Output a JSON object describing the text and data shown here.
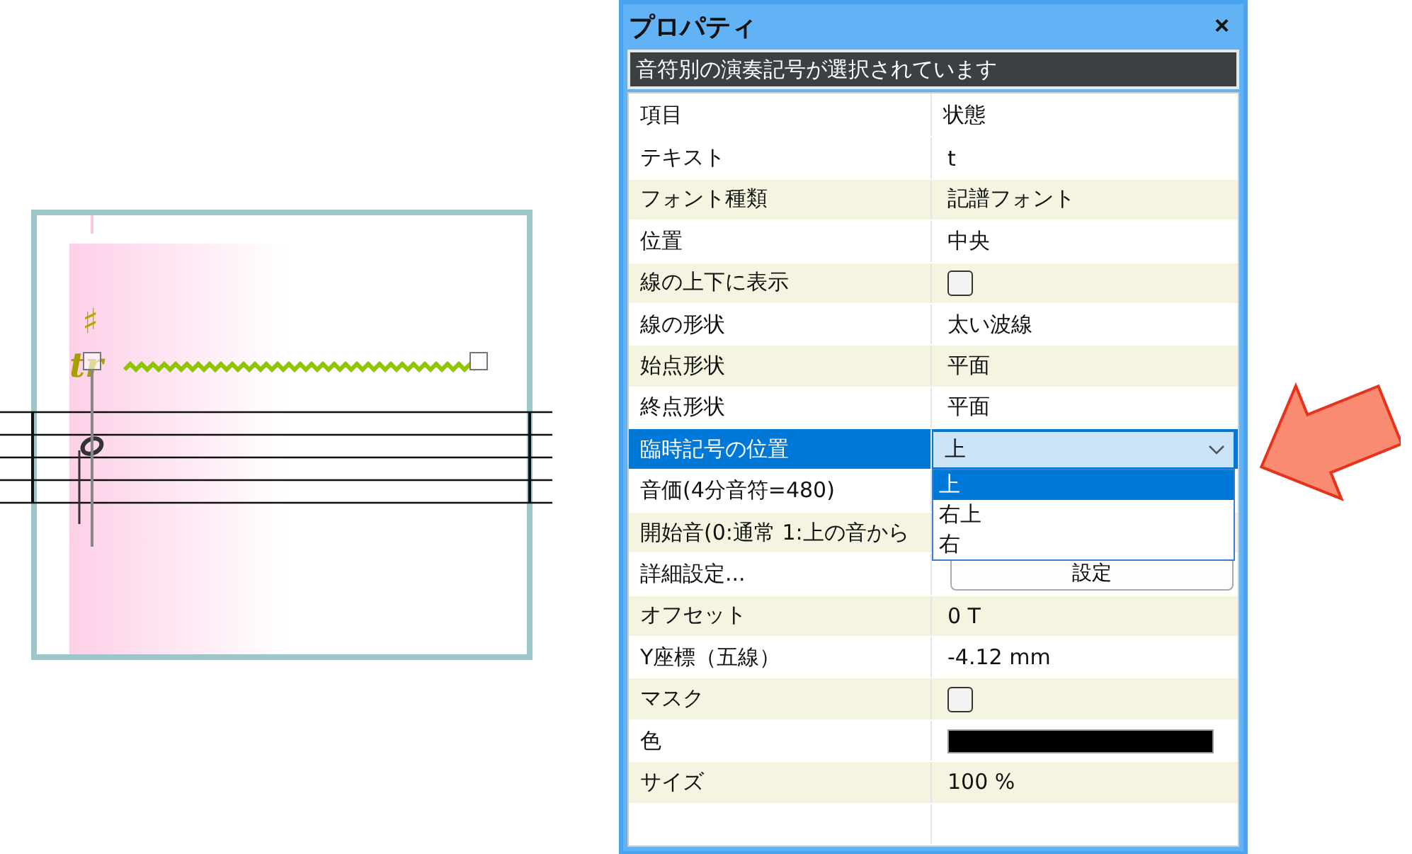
{
  "score": {
    "accidental": "♯",
    "ornament": "tr"
  },
  "panel": {
    "title": "プロパティ",
    "close": "×",
    "status": "音符別の演奏記号が選択されています",
    "columns": [
      "項目",
      "状態"
    ],
    "rows": [
      {
        "kind": "text",
        "label": "テキスト",
        "value": "t",
        "selected": false
      },
      {
        "kind": "text",
        "label": "フォント種類",
        "value": "記譜フォント",
        "selected": false
      },
      {
        "kind": "text",
        "label": "位置",
        "value": "中央",
        "selected": false
      },
      {
        "kind": "checkbox",
        "label": "線の上下に表示",
        "checked": false,
        "selected": false
      },
      {
        "kind": "text",
        "label": "線の形状",
        "value": "太い波線",
        "selected": false
      },
      {
        "kind": "text",
        "label": "始点形状",
        "value": "平面",
        "selected": false
      },
      {
        "kind": "text",
        "label": "終点形状",
        "value": "平面",
        "selected": false
      },
      {
        "kind": "dropdown",
        "label": "臨時記号の位置",
        "value": "上",
        "expanded": true,
        "selected": true,
        "options": [
          {
            "label": "上",
            "selected": true
          },
          {
            "label": "右上",
            "selected": false
          },
          {
            "label": "右",
            "selected": false
          }
        ]
      },
      {
        "kind": "text",
        "label": "音価(4分音符=480)",
        "selected": false
      },
      {
        "kind": "text",
        "label": "開始音(0:通常 1:上の音から",
        "selected": false
      },
      {
        "kind": "button",
        "label": "詳細設定...",
        "value": "設定",
        "selected": false
      },
      {
        "kind": "text",
        "label": "オフセット",
        "value": "0 T",
        "selected": false
      },
      {
        "kind": "text",
        "label": "Y座標（五線）",
        "value": "-4.12 mm",
        "selected": false
      },
      {
        "kind": "checkbox",
        "label": "マスク",
        "checked": false,
        "selected": false
      },
      {
        "kind": "color",
        "label": "色",
        "color": "#000000",
        "selected": false
      },
      {
        "kind": "text",
        "label": "サイズ",
        "value": "100 %",
        "selected": false
      },
      {
        "kind": "empty",
        "selected": false
      }
    ]
  }
}
